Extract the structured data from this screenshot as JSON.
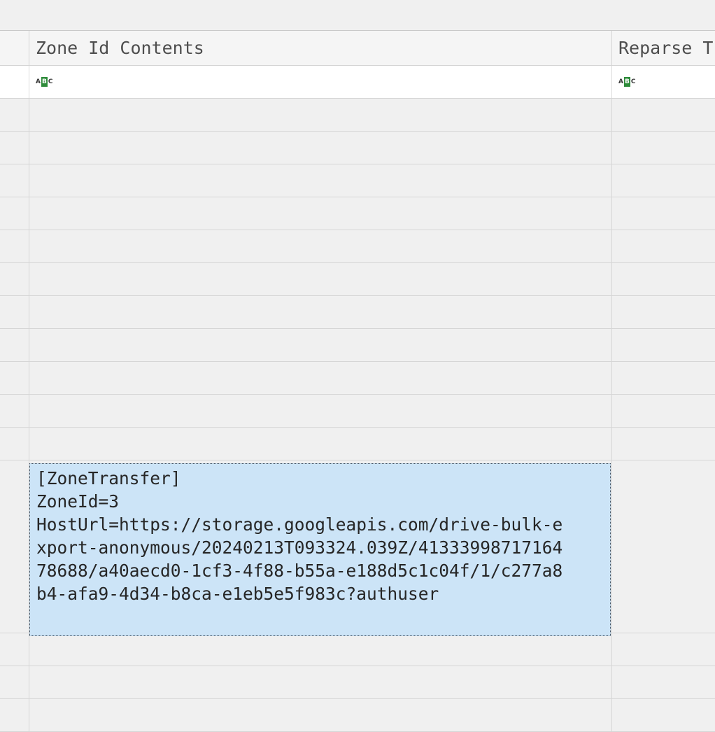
{
  "columns": {
    "zone_id_contents": "Zone Id Contents",
    "reparse": "Reparse T"
  },
  "filter": {
    "icon": "abc-text-filter-icon",
    "icon_letters": [
      "A",
      "B",
      "C"
    ]
  },
  "selected_cell": {
    "lines": [
      "[ZoneTransfer]",
      "ZoneId=3",
      "HostUrl=https://storage.googleapis.com/drive-bulk-e",
      "xport-anonymous/20240213T093324.039Z/41333998717164",
      "78688/a40aecd0-1cf3-4f88-b55a-e188d5c1c04f/1/c277a8",
      "b4-afa9-4d34-b8ca-e1eb5e5f983c?authuser"
    ]
  },
  "colors": {
    "selection": "#cce4f7",
    "grid_line": "#d6d6d6",
    "filter_icon_accent": "#2e8b3a"
  }
}
